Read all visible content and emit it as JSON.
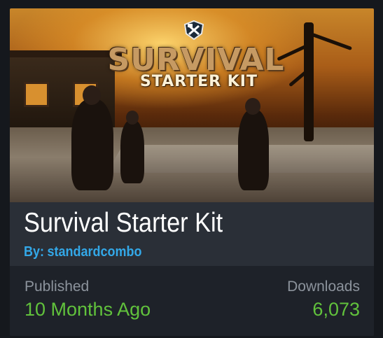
{
  "card": {
    "thumbnail": {
      "logo_title": "SURVIVAL",
      "logo_subtitle": "STARTER KIT",
      "logo_icon": "hammer-wrench-shield-icon"
    },
    "title": "Survival Starter Kit",
    "author_prefix": "By:",
    "author": "standardcombo",
    "published_label": "Published",
    "published_value": "10 Months Ago",
    "downloads_label": "Downloads",
    "downloads_value": "6,073"
  },
  "colors": {
    "background": "#15181d",
    "card": "#2a2f37",
    "stats_band": "#1e2229",
    "title": "#ffffff",
    "author": "#33a8e8",
    "label": "#8c939c",
    "value": "#61c23c"
  }
}
